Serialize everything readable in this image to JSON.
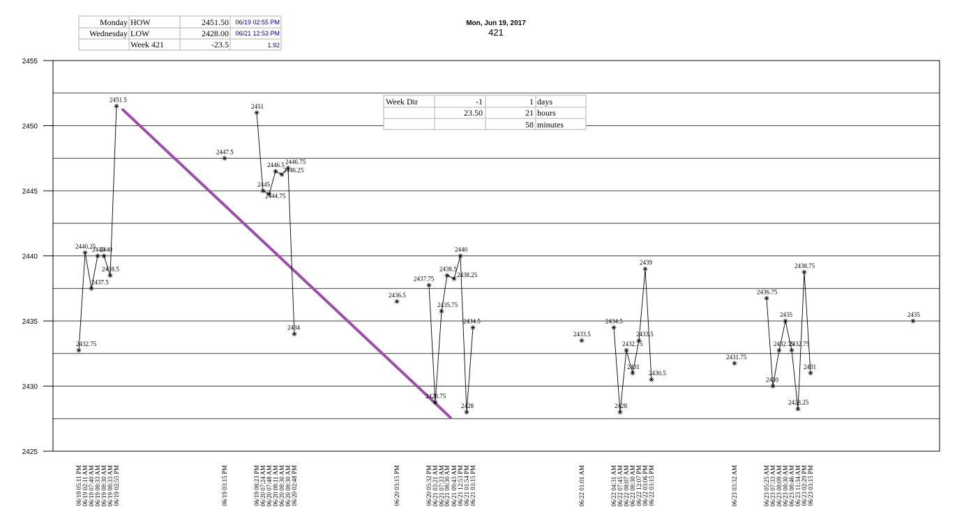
{
  "colors": {
    "trend": "#9b4fa8",
    "grid": "#000000",
    "blue_text": "#00008b"
  },
  "summary_table": {
    "rows": [
      [
        "Monday",
        "HOW",
        "2451.50",
        "06/19 02:55 PM"
      ],
      [
        "Wednesday",
        "LOW",
        "2428.00",
        "06/21 12:53 PM"
      ],
      [
        "",
        "Week 421",
        "-23.5",
        "1.92"
      ]
    ]
  },
  "week_table": {
    "rows": [
      [
        "Week Dir",
        "-1",
        "1",
        "days"
      ],
      [
        "",
        "23.50",
        "21",
        "hours"
      ],
      [
        "",
        "",
        "58",
        "minutes"
      ]
    ]
  },
  "chart_data": {
    "type": "line",
    "title": "Mon, Jun 19, 2017",
    "subtitle": "421",
    "ylim": [
      2425,
      2455
    ],
    "yticks": [
      "2425",
      "2430",
      "2435",
      "2440",
      "2445",
      "2450",
      "2455"
    ],
    "grid": true,
    "x_labels": [
      "06/18 05:11 PM",
      "06/19 02:11 AM",
      "06/19 07:40 AM",
      "06/19 08:33 AM",
      "06/19 08:30 AM",
      "06/19 08:33 AM",
      "06/19 02:55 PM",
      "06/19 03:15 PM",
      "06/19 08:23 PM",
      "06/20 07:24 AM",
      "06/20 07:48 AM",
      "06/20 08:11 AM",
      "06/20 08:30 AM",
      "06/20 08:30 AM",
      "06/20 02:48 PM",
      "06/20 03:15 PM",
      "06/20 05:32 PM",
      "06/21 03:21 AM",
      "06/21 07:33 AM",
      "06/21 08:30 AM",
      "06/21 09:43 AM",
      "06/21 12:53 PM",
      "06/21 01:54 PM",
      "06/21 03:15 PM",
      "06/22 01:01 AM",
      "06/22 04:31 AM",
      "06/22 07:45 AM",
      "06/22 08:07 AM",
      "06/22 08:30 AM",
      "06/22 12:07 PM",
      "06/22 03:06 PM",
      "06/22 03:15 PM",
      "06/23 03:32 AM",
      "06/23 05:25 AM",
      "06/23 07:33 AM",
      "06/23 08:09 AM",
      "06/23 08:30 AM",
      "06/23 08:46 AM",
      "06/23 11:34 AM",
      "06/23 02:29 PM",
      "06/23 03:15 PM"
    ],
    "series": [
      {
        "values": [
          2432.75,
          2440.25,
          2437.5,
          2440,
          2440,
          2438.5,
          2451.5
        ],
        "labels": [
          "2432.75",
          "2440.25",
          "2437.5",
          "2440",
          "2440",
          "2438.5",
          "2451.5"
        ]
      },
      {
        "values": [
          2447.5
        ],
        "labels": [
          "2447.5"
        ]
      },
      {
        "values": [
          2451,
          2445,
          2444.75,
          2446.5,
          2446.25,
          2446.75,
          2434
        ],
        "labels": [
          "2451",
          "2445",
          "2444.75",
          "2446.5",
          "2446.25",
          "2446.75",
          "2434"
        ]
      },
      {
        "values": [
          2436.5
        ],
        "labels": [
          "2436.5"
        ]
      },
      {
        "values": [
          2437.75,
          2428.75,
          2435.75,
          2438.5,
          2438.25,
          2440,
          2428,
          2434.5
        ],
        "labels": [
          "2437.75",
          "2428.75",
          "2435.75",
          "2438.5",
          "2438.25",
          "2440",
          "2428",
          "2434.5"
        ]
      },
      {
        "values": [
          2433.5
        ],
        "labels": [
          "2433.5"
        ]
      },
      {
        "values": [
          2434.5,
          2428,
          2432.75,
          2431,
          2433.5,
          2439,
          2430.5
        ],
        "labels": [
          "2434.5",
          "2428",
          "2432.75",
          "2431",
          "2433.5",
          "2439",
          "2430.5"
        ]
      },
      {
        "values": [
          2431.75
        ],
        "labels": [
          "2431.75"
        ]
      },
      {
        "values": [
          2436.75,
          2430,
          2432.75,
          2435,
          2432.75,
          2428.25,
          2438.75,
          2431
        ],
        "labels": [
          "2436.75",
          "2430",
          "2432.75",
          "2435",
          "2432.75",
          "2428.25",
          "2438.75",
          "2431"
        ]
      },
      {
        "values": [
          2435
        ],
        "labels": [
          "2435"
        ]
      }
    ],
    "trendline": {
      "from": [
        2451.5
      ],
      "to": [
        2428
      ]
    }
  }
}
